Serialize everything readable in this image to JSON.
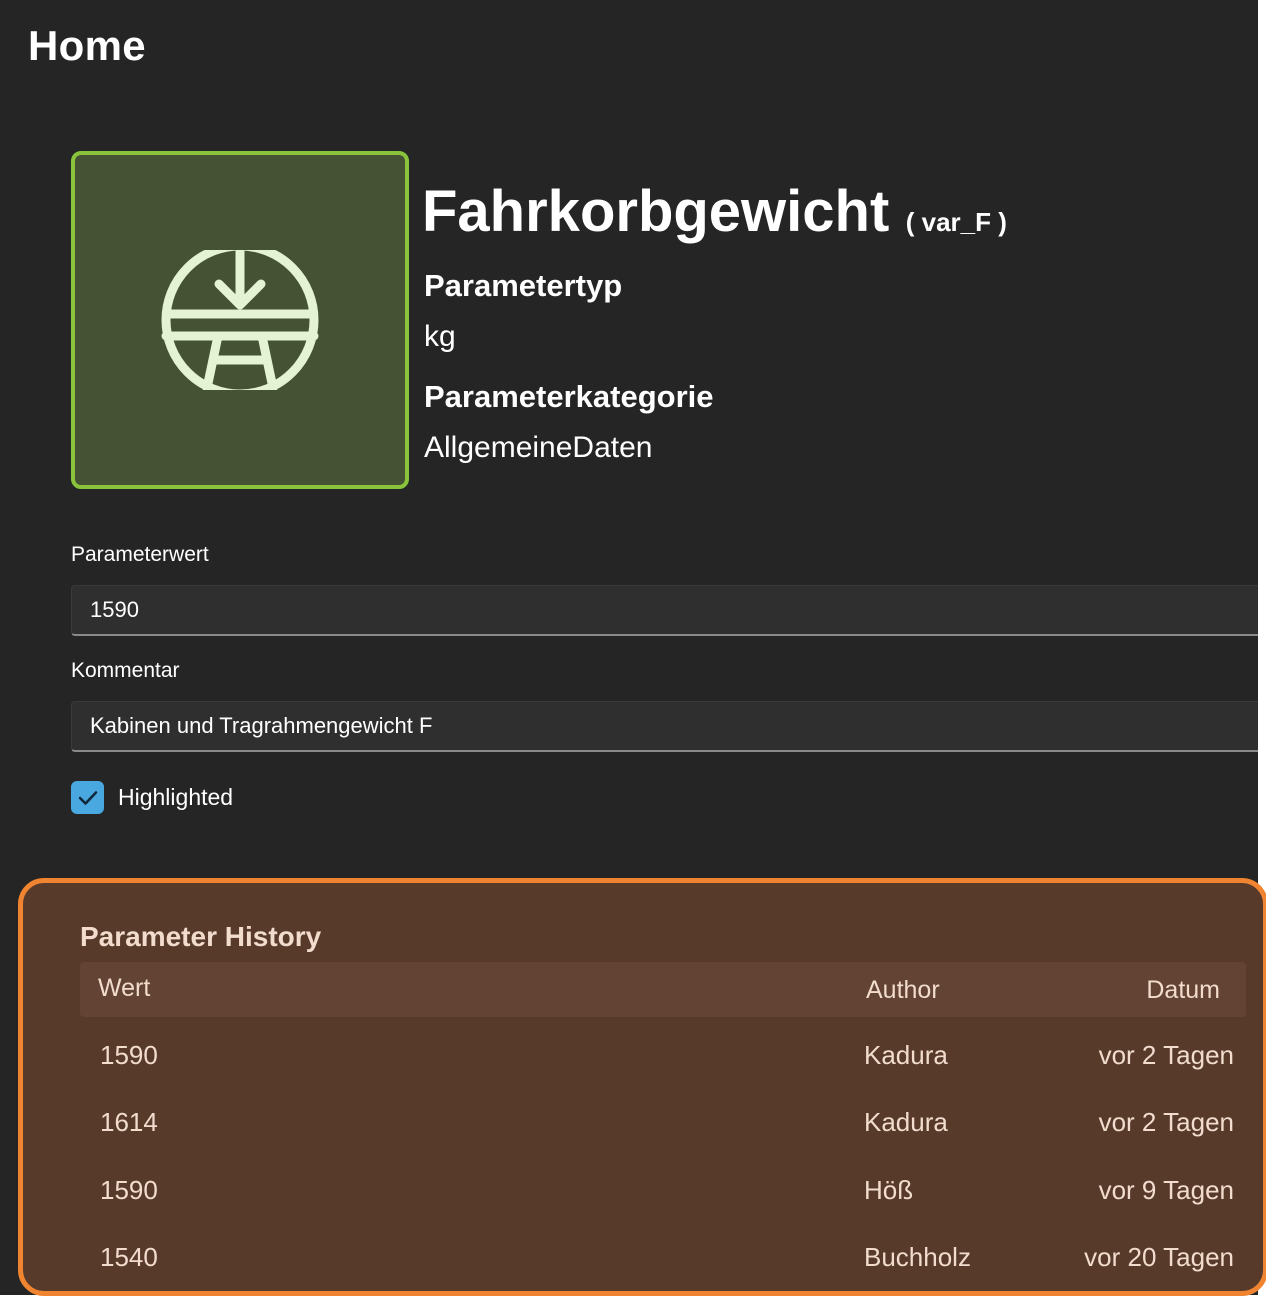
{
  "page": {
    "title": "Home"
  },
  "parameter": {
    "icon": "scale-weight-icon",
    "name": "Fahrkorbgewicht",
    "var_text": "( var_F )",
    "type_label": "Parametertyp",
    "type_value": "kg",
    "category_label": "Parameterkategorie",
    "category_value": "AllgemeineDaten"
  },
  "form": {
    "value_label": "Parameterwert",
    "value": "1590",
    "comment_label": "Kommentar",
    "comment": "Kabinen und Tragrahmengewicht F",
    "highlighted_label": "Highlighted",
    "highlighted_checked": true
  },
  "history": {
    "title": "Parameter History",
    "columns": {
      "wert": "Wert",
      "author": "Author",
      "datum": "Datum"
    },
    "rows": [
      {
        "wert": "1590",
        "author": "Kadura",
        "datum": "vor 2 Tagen"
      },
      {
        "wert": "1614",
        "author": "Kadura",
        "datum": "vor 2 Tagen"
      },
      {
        "wert": "1590",
        "author": "Höß",
        "datum": "vor 9 Tagen"
      },
      {
        "wert": "1540",
        "author": "Buchholz",
        "datum": "vor 20 Tagen"
      }
    ]
  },
  "colors": {
    "background": "#252525",
    "icon_box": "#465234",
    "icon_border": "#8ac43b",
    "icon_stroke": "#e3f3d3",
    "checkbox": "#4aa8e0",
    "history_bg": "#583a2b",
    "history_border": "#f08430",
    "history_text": "#f1dccd"
  }
}
